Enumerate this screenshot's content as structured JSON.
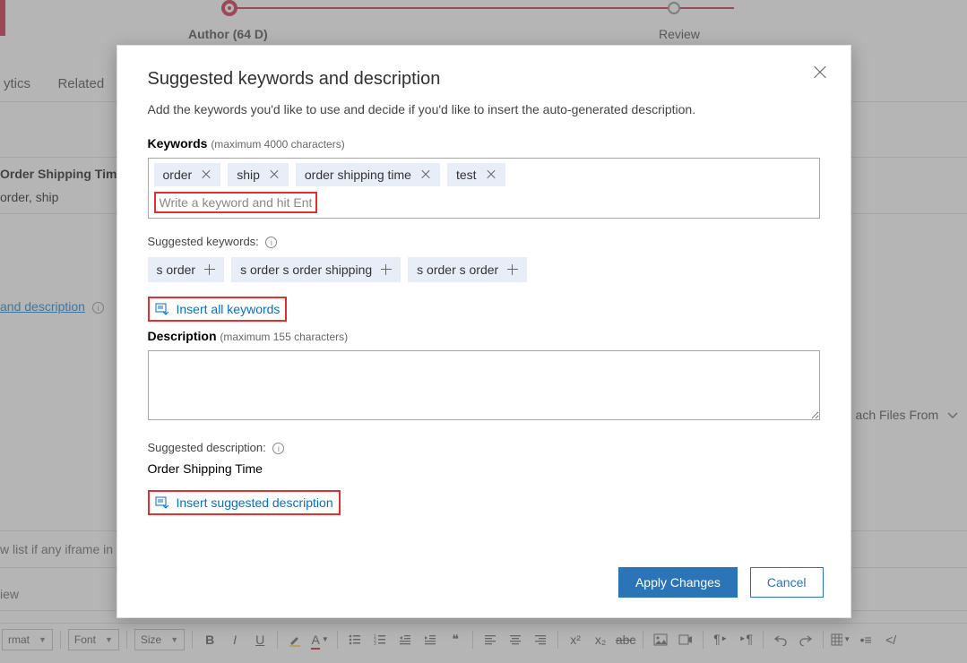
{
  "progress": {
    "author_label": "Author  (64 D)",
    "review_label": "Review"
  },
  "tabs": {
    "analytics": "ytics",
    "related": "Related"
  },
  "fields": {
    "title_label": "Order Shipping Time",
    "kw_field": "order, ship"
  },
  "bg_link": {
    "text": "and description"
  },
  "attach": {
    "label": "ach Files From"
  },
  "iframe_row": "w list if any iframe in t",
  "view_row": "iew",
  "toolbar": {
    "format": "rmat",
    "font": "Font",
    "size": "Size"
  },
  "modal": {
    "title": "Suggested keywords and description",
    "subtitle": "Add the keywords you'd like to use and decide if you'd like to insert the auto-generated description.",
    "kw_label": "Keywords",
    "kw_hint": "(maximum 4000 characters)",
    "tags": [
      "order",
      "ship",
      "order shipping time",
      "test"
    ],
    "kw_placeholder": "Write a keyword and hit Enter",
    "sug_label": "Suggested keywords:",
    "sug_tags": [
      "s order",
      "s order s order shipping",
      "s order s order"
    ],
    "insert_all": "Insert all keywords",
    "desc_label": "Description",
    "desc_hint": "(maximum 155 characters)",
    "sug_desc_label": "Suggested description:",
    "sug_desc_value": "Order Shipping Time",
    "insert_desc": "Insert suggested description",
    "apply": "Apply Changes",
    "cancel": "Cancel"
  }
}
